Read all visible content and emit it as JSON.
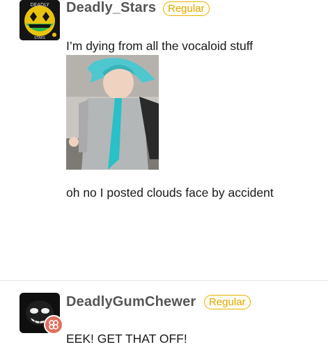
{
  "posts": [
    {
      "username": "Deadly_Stars",
      "badge": "Regular",
      "avatar_icon": "deadly-stars-avatar",
      "avatar_text": "DEADLY",
      "avatar_subtext": "STARS",
      "message": "I’m dying from all the vocaloid stuff",
      "image_icon": "cosplay-photo",
      "followup": "oh no I posted clouds face by accident"
    },
    {
      "username": "DeadlyGumChewer",
      "badge": "Regular",
      "avatar_icon": "skull-face-avatar",
      "role_icon": "group-icon",
      "message": "EEK! GET THAT OFF!"
    }
  ],
  "colors": {
    "badge": "#e0a800",
    "username": "#555555",
    "role_badge": "#e0705f"
  }
}
